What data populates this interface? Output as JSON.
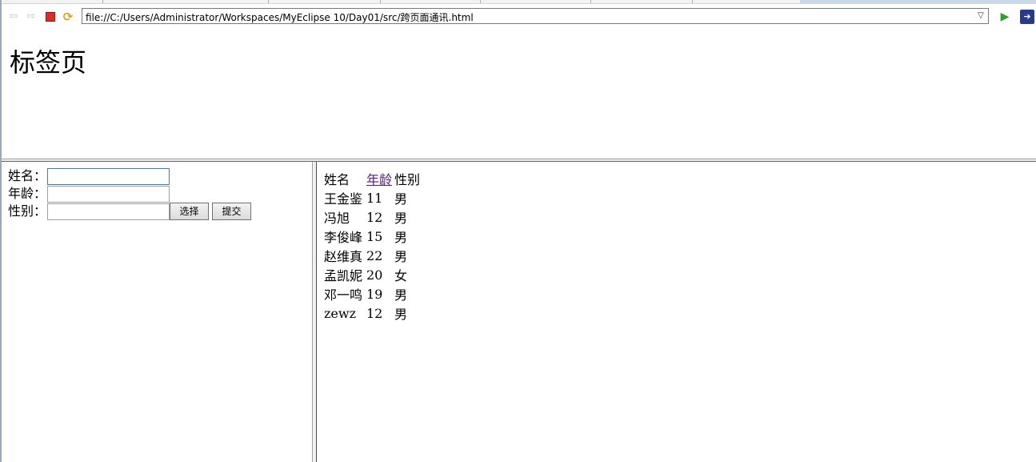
{
  "browser": {
    "url": "file://C:/Users/Administrator/Workspaces/MyEclipse 10/Day01/src/跨页面通讯.html",
    "icons": {
      "back": "back-arrow-icon",
      "forward": "forward-arrow-icon",
      "stop": "stop-icon",
      "refresh": "refresh-icon",
      "dropdown": "chevron-down-icon",
      "go": "go-play-icon",
      "external": "external-browser-icon"
    }
  },
  "top_frame": {
    "title": "标签页"
  },
  "form": {
    "name_label": "姓名：",
    "name_value": "",
    "age_label": "年龄：",
    "age_value": "",
    "gender_label": "性别：",
    "gender_value": "",
    "choose_button": "选择",
    "submit_button": "提交"
  },
  "table": {
    "headers": {
      "name": "姓名",
      "age": "年龄",
      "gender": "性别"
    },
    "rows": [
      {
        "name": "王金鉴",
        "age": "11",
        "gender": "男"
      },
      {
        "name": "冯旭",
        "age": "12",
        "gender": "男"
      },
      {
        "name": "李俊峰",
        "age": "15",
        "gender": "男"
      },
      {
        "name": "赵维真",
        "age": "22",
        "gender": "男"
      },
      {
        "name": "孟凯妮",
        "age": "20",
        "gender": "女"
      },
      {
        "name": "邓一鸣",
        "age": "19",
        "gender": "男"
      },
      {
        "name": "zewz",
        "age": "12",
        "gender": "男"
      }
    ]
  },
  "colors": {
    "visited_link": "#551a8b",
    "stop_red": "#e02a2a",
    "go_green": "#2ca02c",
    "focus_border": "#3c7fb1"
  }
}
